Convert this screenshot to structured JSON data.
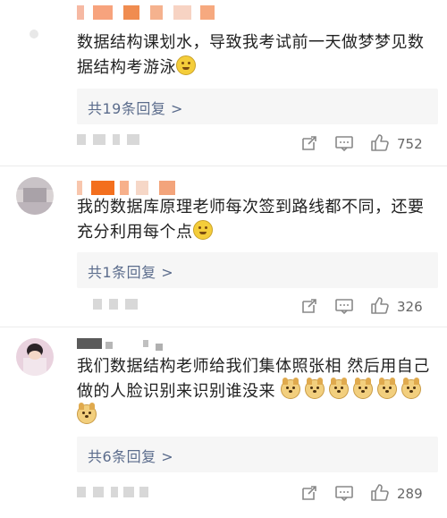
{
  "comments": [
    {
      "text": "数据结构课划水，导致我考试前一天做梦梦见数据结构考游泳",
      "emoji": "smiling-face",
      "replies_label": "共19条回复 >",
      "likes": "752"
    },
    {
      "text": "我的数据库原理老师每次签到路线都不同，还要充分利用每个点",
      "emoji": "crying-laughing-face",
      "replies_label": "共1条回复 >",
      "likes": "326"
    },
    {
      "text": "我们数据结构老师给我们集体照张相 然后用自己做的人脸识别来识别谁没来",
      "emoji": "doge-face",
      "emoji_count": 7,
      "replies_label": "共6条回复 >",
      "likes": "289"
    }
  ],
  "icons": {
    "repost": "repost-icon",
    "comment": "comment-icon",
    "like": "thumbs-up-icon"
  },
  "colors": {
    "link": "#5b6c8c",
    "reply_bg": "#f6f6f6",
    "username_orange": "#f36f1e"
  }
}
